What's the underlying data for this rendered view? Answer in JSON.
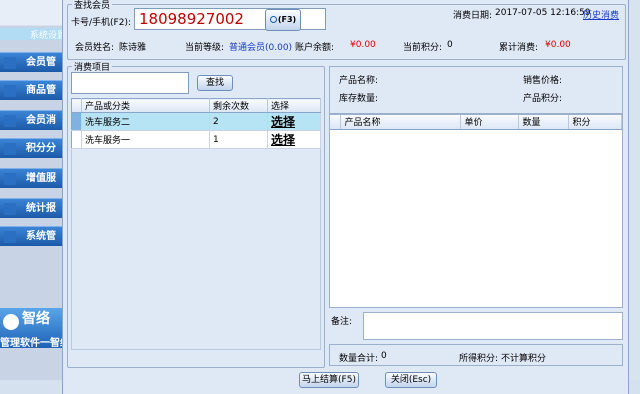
{
  "background": {
    "title": "系统设置",
    "nav": [
      "会员管",
      "商品管",
      "会员消",
      "积分分",
      "增值服",
      "统计报",
      "系统管"
    ],
    "logo": "智络",
    "slogan": "管理软件一智络"
  },
  "member_group": {
    "legend": "查找会员",
    "card_label": "卡号/手机(F2):",
    "card_value": "18098927002",
    "search_btn": "(F3)",
    "date_label": "消费日期:",
    "date_value": "2017-07-05 12:16:59",
    "history_link": "历史消费",
    "name_label": "会员姓名:",
    "name_value": "陈诗雅",
    "level_label": "当前等级:",
    "level_value": "普通会员(0.00)",
    "balance_label": "账户余额:",
    "balance_value": "¥0.00",
    "points_label": "当前积分:",
    "points_value": "0",
    "total_label": "累计消费:",
    "total_value": "¥0.00"
  },
  "service_group": {
    "legend": "消费项目",
    "filter_placeholder": "",
    "find_btn": "查找",
    "columns": [
      "产品或分类",
      "剩余次数",
      "选择"
    ],
    "rows": [
      {
        "name": "洗车服务二",
        "remaining": "2",
        "action": "选择"
      },
      {
        "name": "洗车服务一",
        "remaining": "1",
        "action": "选择"
      }
    ]
  },
  "detail": {
    "product_name_label": "产品名称:",
    "price_label": "销售价格:",
    "stock_label": "库存数量:",
    "points_label": "产品积分:",
    "columns": [
      "产品名称",
      "单价",
      "数量",
      "积分"
    ]
  },
  "footer": {
    "remark_label": "备注:",
    "qty_total_label": "数量合计:",
    "qty_total_value": "0",
    "earned_label": "所得积分:",
    "earned_value": "不计算积分",
    "settle_btn": "马上结算(F5)",
    "close_btn": "关闭(Esc)"
  }
}
